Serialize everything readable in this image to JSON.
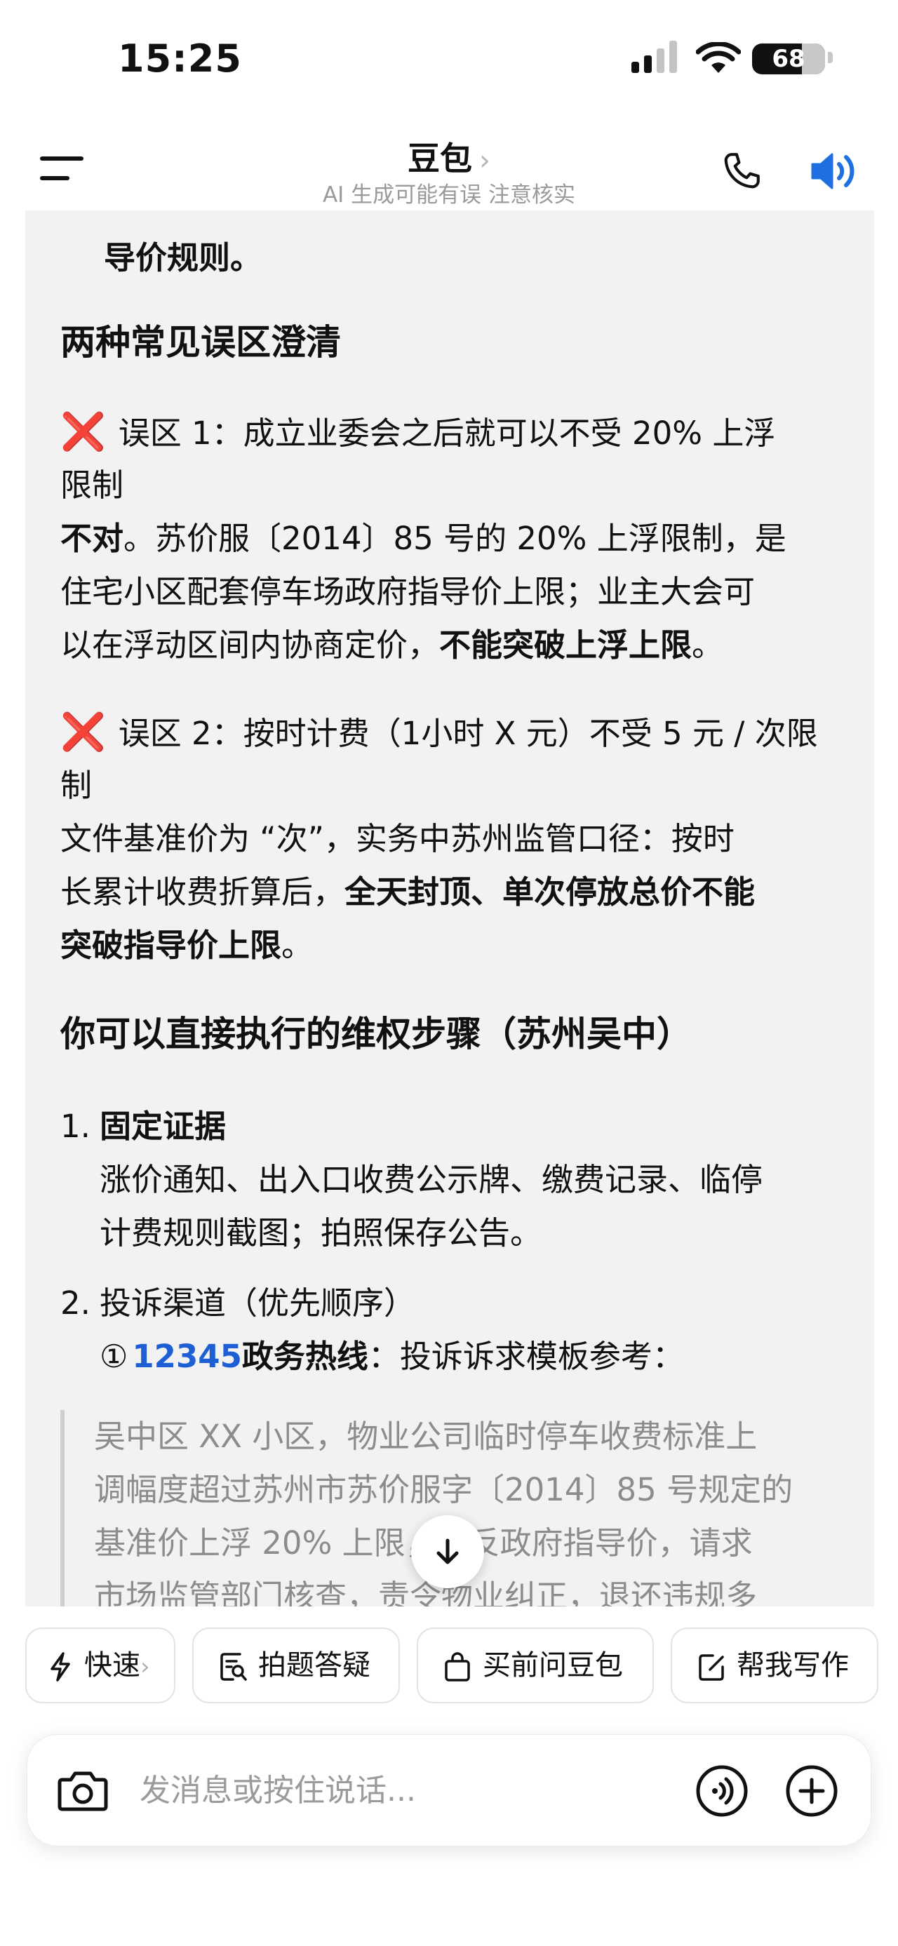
{
  "status_bar": {
    "time": "15:25",
    "battery": "68",
    "battery_level_percent": 68
  },
  "header": {
    "title": "豆包",
    "chevron": "›",
    "subtitle": "AI 生成可能有误 注意核实"
  },
  "message": {
    "prev_line": "导价规则。",
    "section1_heading": "两种常见误区澄清",
    "myth1": {
      "mark": "❌",
      "title_l1": "误区 1：成立业委会之后就可以不受 20% 上浮",
      "title_l2": "限制",
      "body_bold1": "不对",
      "body_l1_rest": "。苏价服〔2014〕85 号的 20% 上浮限制，是",
      "body_l2": "住宅小区配套停车场政府指导价上限；业主大会可",
      "body_l3_plain": "以在浮动区间内协商定价，",
      "body_l3_bold": "不能突破上浮上限",
      "body_l3_end": "。"
    },
    "myth2": {
      "mark": "❌",
      "title_l1": "误区 2：按时计费（1小时 X 元）不受 5 元 / 次限",
      "title_l2": "制",
      "body_l1": "文件基准价为 “次”，实务中苏州监管口径：按时",
      "body_l2_plain": "长累计收费折算后，",
      "body_l2_bold": "全天封顶、单次停放总价不能",
      "body_l3_bold": "突破指导价上限",
      "body_l3_end": "。"
    },
    "section2_heading": "你可以直接执行的维权步骤（苏州吴中）",
    "step1": {
      "num": "1.",
      "title": "固定证据",
      "body_l1": "涨价通知、出入口收费公示牌、缴费记录、临停",
      "body_l2": "计费规则截图；拍照保存公告。"
    },
    "step2": {
      "num": "2.",
      "title": "投诉渠道（优先顺序）",
      "circle": "①",
      "hotline": "12345",
      "hotline_label": "政务热线",
      "hotline_rest": "：投诉诉求模板参考："
    },
    "quote": {
      "l1": "吴中区 XX 小区，物业公司临时停车收费标准上",
      "l2": "调幅度超过苏州市苏价服字〔2014〕85 号规定的",
      "l3": "基准价上浮 20% 上限，违反政府指导价，请求",
      "l4": "市场监管部门核查，责令物业纠正，退还违规多"
    }
  },
  "quick_actions": [
    {
      "label": "快速",
      "icon": "lightning-icon",
      "chevron": "›"
    },
    {
      "label": "拍题答疑",
      "icon": "photo-question-icon"
    },
    {
      "label": "买前问豆包",
      "icon": "shopping-bag-icon"
    },
    {
      "label": "帮我写作",
      "icon": "edit-icon"
    }
  ],
  "input": {
    "placeholder": "发消息或按住说话..."
  },
  "colors": {
    "accent_blue": "#1f5fd6",
    "error_red": "#e1251b",
    "content_bg": "#f2f2f3"
  }
}
